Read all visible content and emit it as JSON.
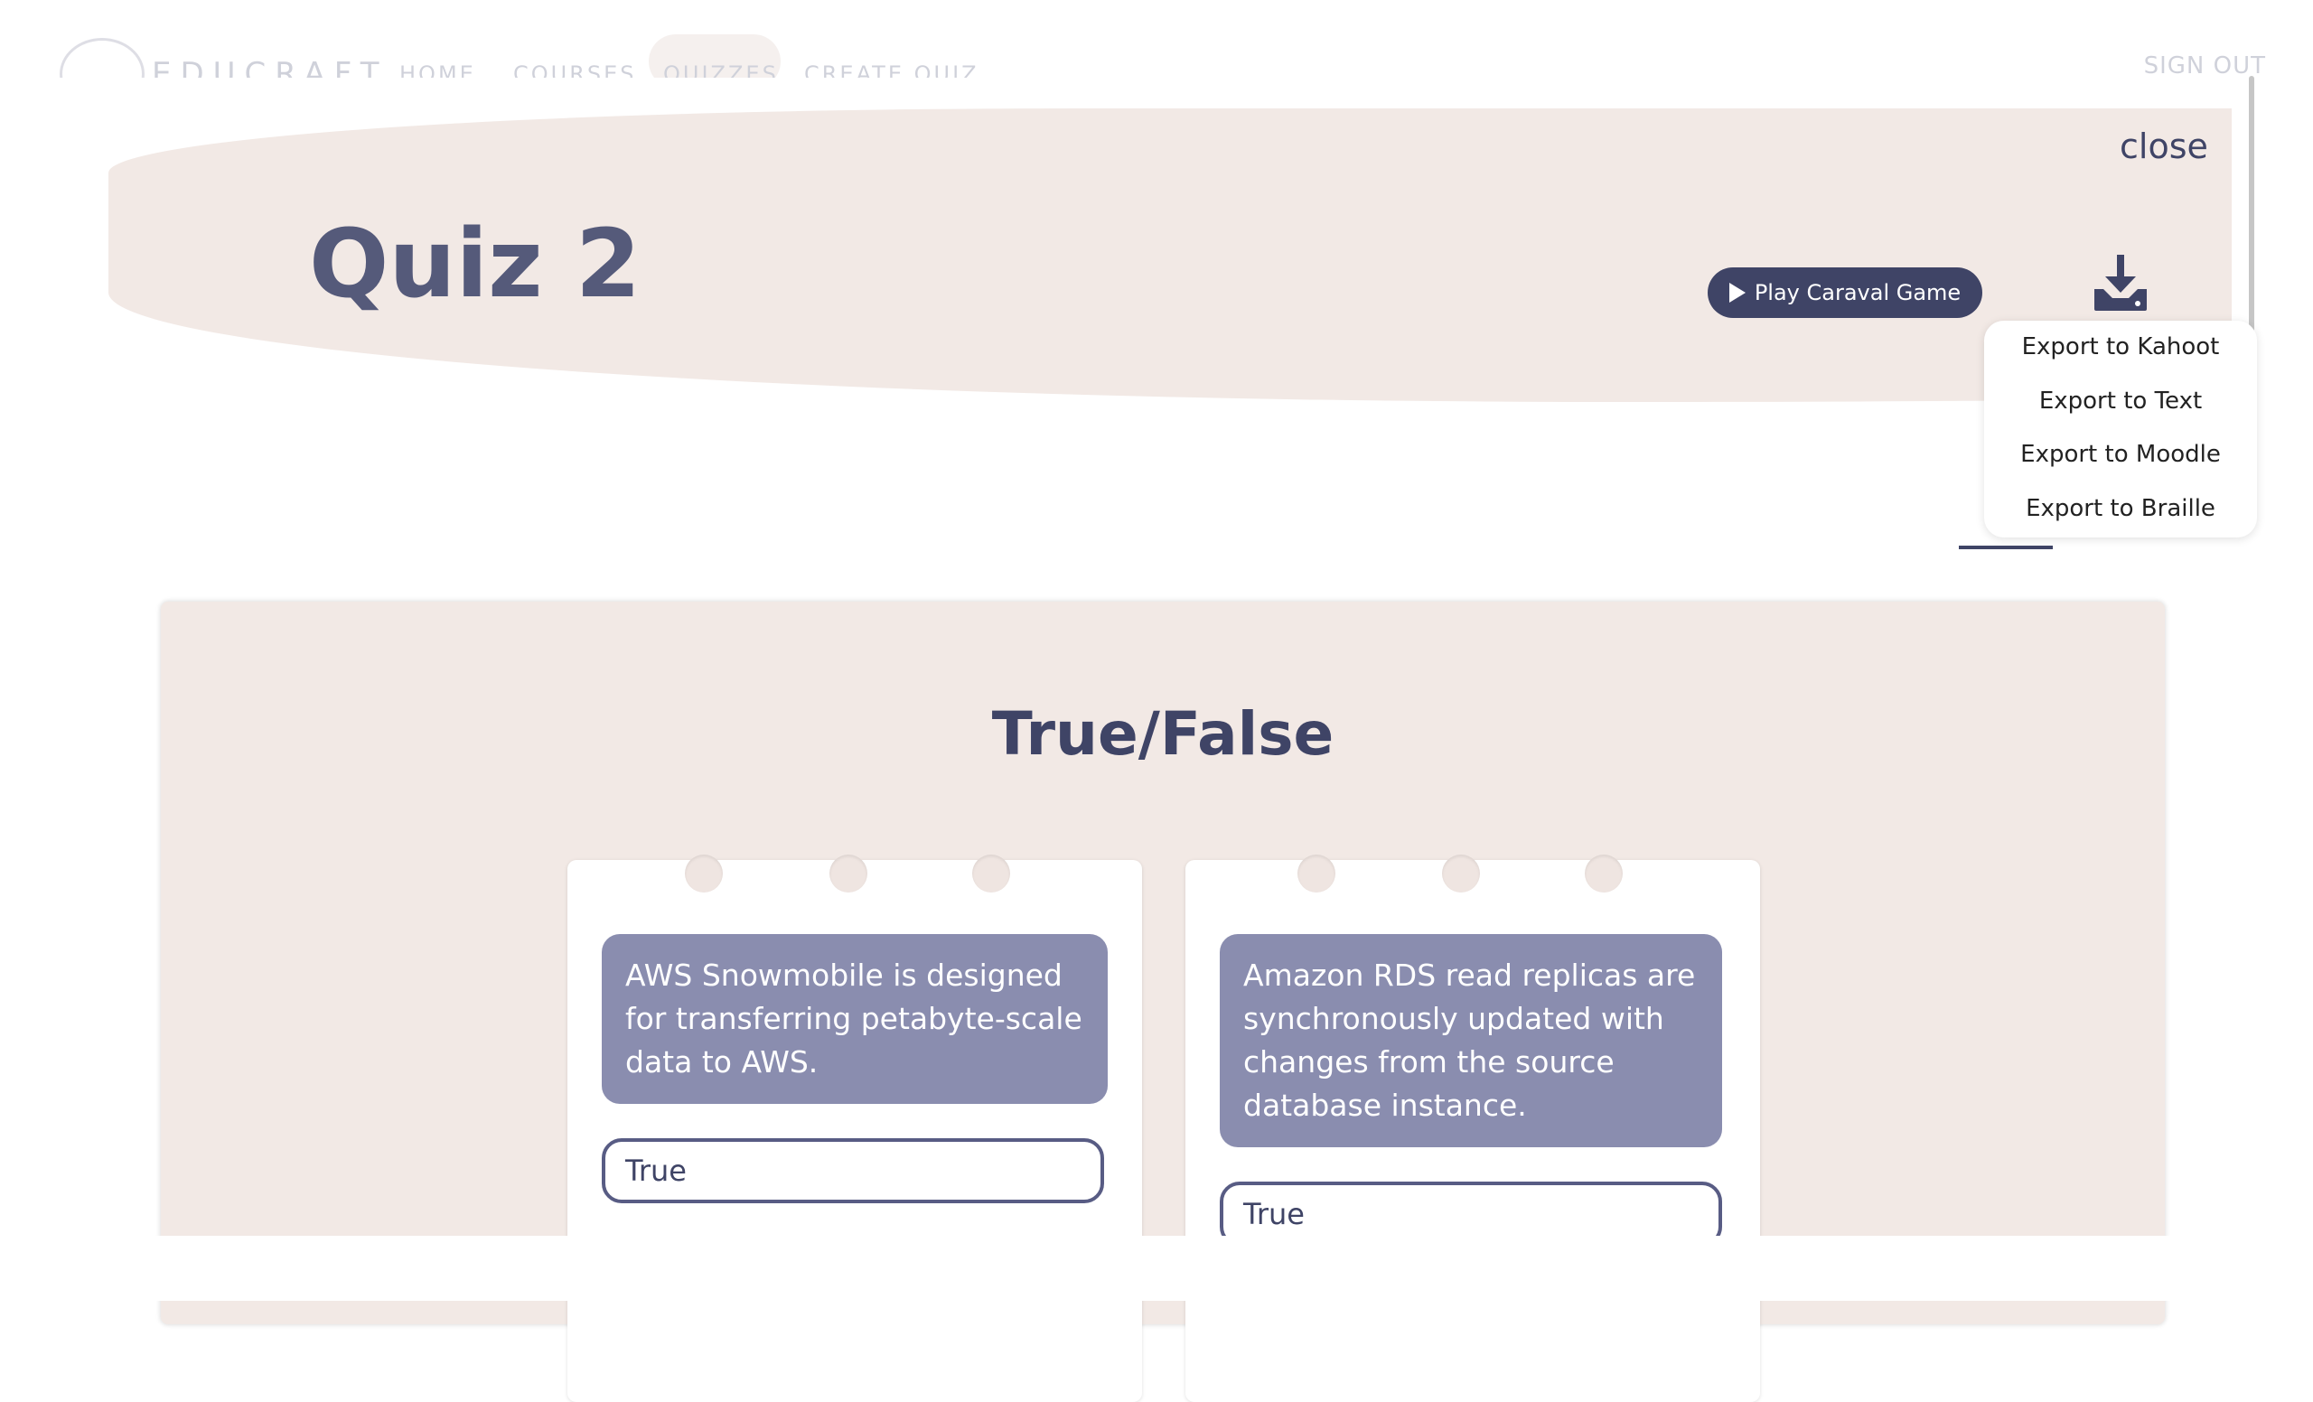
{
  "nav": {
    "brand": "EDUCRAFT",
    "links": [
      "HOME",
      "COURSES",
      "QUIZZES",
      "CREATE QUIZ"
    ],
    "sign_out": "SIGN OUT"
  },
  "modal": {
    "close_label": "close",
    "title": "Quiz 2",
    "play_button": "Play Caraval Game",
    "export_menu": [
      "Export to Kahoot",
      "Export to Text",
      "Export to Moodle",
      "Export to Braille"
    ]
  },
  "section": {
    "title": "True/False",
    "cards": [
      {
        "question": "AWS Snowmobile is designed for transferring petabyte-scale data to AWS.",
        "answer": "True"
      },
      {
        "question": "Amazon RDS read replicas are synchronously updated with changes from the source database instance.",
        "answer": "True"
      }
    ]
  },
  "colors": {
    "accent": "#3f4466",
    "panel_bg": "#f2e9e5",
    "question_bg": "#8a8daf"
  }
}
